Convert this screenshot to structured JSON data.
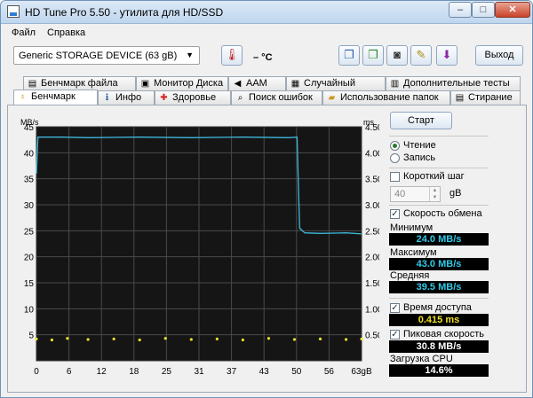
{
  "window": {
    "title": "HD Tune Pro 5.50 - утилита для HD/SSD",
    "minimize": "–",
    "maximize": "□",
    "close": "✕"
  },
  "menu": [
    "Файл",
    "Справка"
  ],
  "toolbar": {
    "device": "Generic STORAGE DEVICE (63 gB)",
    "temperature": "– °C",
    "exit_label": "Выход",
    "icons": [
      "thermometer-icon",
      "copy-text-icon",
      "copy-screenshot-icon",
      "camera-icon",
      "options-icon",
      "save-icon"
    ]
  },
  "tabs_row1": [
    "Бенчмарк файла",
    "Монитор Диска",
    "AAM",
    "Случайный доступ",
    "Дополнительные тесты"
  ],
  "tabs_row2": [
    "Бенчмарк",
    "Инфо",
    "Здоровье",
    "Поиск ошибок",
    "Использование папок",
    "Стирание"
  ],
  "active_tab": "Бенчмарк",
  "controls": {
    "start_label": "Старт",
    "read_label": "Чтение",
    "write_label": "Запись",
    "mode_selected": "read",
    "short_step_label": "Короткий шаг",
    "short_step_checked": false,
    "step_value": "40",
    "step_unit": "gB",
    "transfer_rate_label": "Скорость обмена",
    "transfer_rate_checked": true,
    "access_time_label": "Время доступа",
    "access_time_checked": true,
    "burst_label": "Пиковая скорость",
    "burst_checked": true
  },
  "results": {
    "min_label": "Минимум",
    "min_value": "24.0 MB/s",
    "max_label": "Максимум",
    "max_value": "43.0 MB/s",
    "avg_label": "Средняя",
    "avg_value": "39.5 MB/s",
    "access_value": "0.415 ms",
    "burst_value": "30.8 MB/s",
    "cpu_label": "Загрузка CPU",
    "cpu_value": "14.6%"
  },
  "colors": {
    "transfer_line": "#3fb8dc",
    "access_points": "#e8e030",
    "grid": "#4a4a4a",
    "plot_bg": "#151515"
  },
  "chart_data": {
    "type": "line",
    "left_unit": "MB/s",
    "right_unit": "ms",
    "y_ticks": [
      "45",
      "40",
      "35",
      "30",
      "25",
      "20",
      "15",
      "10",
      "5"
    ],
    "y2_ticks": [
      "4.50",
      "4.00",
      "3.50",
      "3.00",
      "2.50",
      "2.00",
      "1.50",
      "1.00",
      "0.50"
    ],
    "x_ticks": [
      "0",
      "6",
      "12",
      "18",
      "25",
      "31",
      "37",
      "43",
      "50",
      "56",
      "63gB"
    ],
    "xlim": [
      0,
      63
    ],
    "ylim": [
      0,
      45
    ],
    "y2lim": [
      0,
      4.5
    ],
    "series": [
      {
        "name": "Скорость обмена",
        "x": [
          0,
          0.3,
          1,
          5,
          10,
          20,
          30,
          40,
          49,
          50.5,
          51,
          52,
          55,
          60,
          63
        ],
        "values": [
          36,
          43,
          43,
          43,
          42.9,
          43,
          42.9,
          43,
          42.9,
          43,
          25.5,
          24.6,
          24.5,
          24.6,
          24.4
        ]
      },
      {
        "name": "Время доступа",
        "x": [
          0,
          3,
          6,
          10,
          15,
          20,
          25,
          30,
          35,
          40,
          45,
          50,
          55,
          60,
          63
        ],
        "values": [
          0.42,
          0.4,
          0.43,
          0.41,
          0.42,
          0.4,
          0.43,
          0.41,
          0.42,
          0.4,
          0.43,
          0.41,
          0.42,
          0.41,
          0.42
        ]
      }
    ]
  }
}
